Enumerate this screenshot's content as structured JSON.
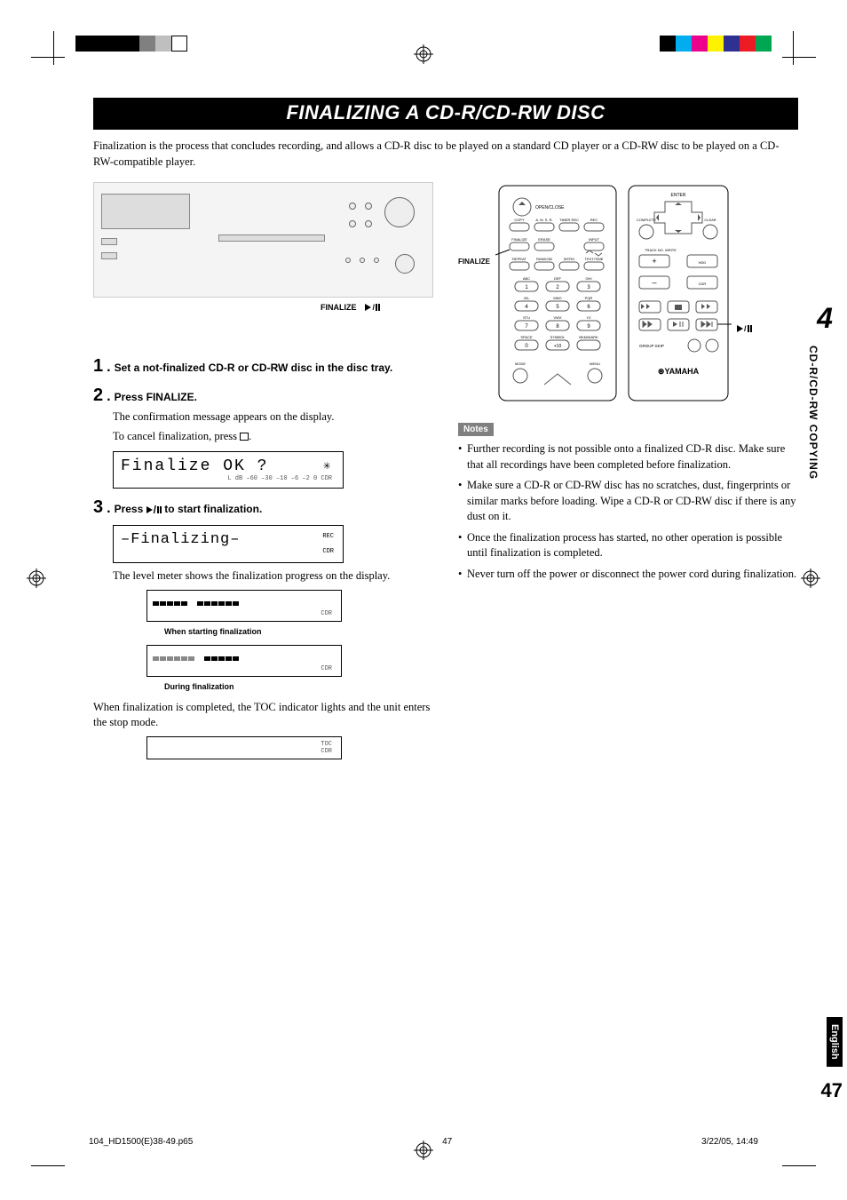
{
  "domain": "Document",
  "section_title": "FINALIZING A CD-R/CD-RW DISC",
  "intro": "Finalization is the process that concludes recording, and allows a CD-R disc to be played on a standard CD player or a CD-RW disc to be played on a CD-RW-compatible player.",
  "device_labels": {
    "finalize": "FINALIZE",
    "play_pause": "▷/□□"
  },
  "remote_left_label": "FINALIZE",
  "remote_right_label": "▷/□□",
  "remote_buttons": {
    "open_close": "OPEN/CLOSE",
    "row1": [
      "COPY",
      "A. M. S. R.",
      "TIMER REC",
      "REC"
    ],
    "row2_left": [
      "FINALIZE",
      "ERASE"
    ],
    "row2_right": "INPUT",
    "row3": [
      "REPEAT",
      "RANDOM",
      "INTRO",
      "TEXT/TIME"
    ],
    "letters_row1": [
      "ABC",
      "DEF",
      "GHI"
    ],
    "nums_row1": [
      "1",
      "2",
      "3"
    ],
    "letters_row2": [
      "JKL",
      "MNO",
      "PQR"
    ],
    "nums_row2": [
      "4",
      "5",
      "6"
    ],
    "letters_row3": [
      "STU",
      "VWX",
      "YZ"
    ],
    "nums_row3": [
      "7",
      "8",
      "9"
    ],
    "letters_row4": [
      "SPACE",
      "SYMBOL",
      "BKM/MARK"
    ],
    "nums_row4": [
      "0",
      "+10",
      ""
    ],
    "bottom": [
      "MODE",
      "",
      "MENU"
    ]
  },
  "remote_right_panel": {
    "enter": "ENTER",
    "complete": "COMPLETE",
    "clear": "CLEAR",
    "track_no_write": "TRACK NO. WRITE",
    "hdd": "HDD",
    "cdr": "CDR",
    "group_skip": "GROUP SKIP",
    "brand": "YAMAHA"
  },
  "steps": {
    "s1": {
      "num": "1",
      "title": "Set a not-finalized CD-R or CD-RW disc in the disc tray."
    },
    "s2": {
      "num": "2",
      "title": "Press FINALIZE.",
      "body1": "The confirmation message appears on the display.",
      "body2_prefix": "To cancel finalization, press ",
      "body2_suffix": "."
    },
    "lcd1": {
      "main": "Finalize  OK  ?",
      "sub": "L   dB  –60     –30     –10  –6  –2   0        CDR",
      "sub_right": "CDR"
    },
    "s3": {
      "num": "3",
      "title_prefix": "Press ",
      "title_suffix": " to start finalization.",
      "body": "The level meter shows the finalization progress on the display."
    },
    "lcd2": {
      "main": "–Finalizing–",
      "rec": "REC",
      "cdr": "CDR"
    },
    "meter1_caption": "When starting finalization",
    "meter2_caption": "During finalization",
    "after": "When finalization is completed, the TOC indicator lights and the unit enters the stop mode.",
    "toc_label": "TOC",
    "cdr_label": "CDR"
  },
  "notes_title": "Notes",
  "notes": [
    "Further recording is not possible onto a finalized CD-R disc. Make sure that all recordings have been completed before finalization.",
    "Make sure a CD-R or CD-RW disc has no scratches, dust, fingerprints or similar marks before loading. Wipe a CD-R or CD-RW disc if there is any dust on it.",
    "Once the finalization process has started, no other operation is possible until finalization is completed.",
    "Never turn off the power or disconnect the power cord during finalization."
  ],
  "side_tab": {
    "chapter": "4",
    "label": "CD-R/CD-RW COPYING"
  },
  "language": "English",
  "page_number": "47",
  "footer": {
    "file": "104_HD1500(E)38-49.p65",
    "page": "47",
    "date": "3/22/05, 14:49"
  }
}
